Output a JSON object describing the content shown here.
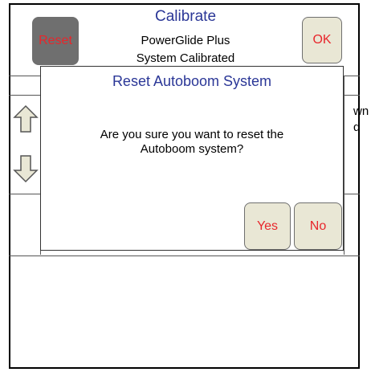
{
  "header": {
    "title": "Calibrate",
    "subtitle": "PowerGlide Plus",
    "status": "System Calibrated",
    "reset_label": "Reset",
    "ok_label": "OK"
  },
  "background": {
    "partial_text_line1": "wn",
    "partial_text_line2": "d"
  },
  "dialog": {
    "title": "Reset Autoboom System",
    "message_line1": "Are you sure you want to reset the",
    "message_line2": "Autoboom system?",
    "yes_label": "Yes",
    "no_label": "No"
  },
  "colors": {
    "title_blue": "#2b3797",
    "button_text_red": "#e8262b",
    "button_bg": "#e9e7d5",
    "reset_bg": "#6f6f6f"
  }
}
